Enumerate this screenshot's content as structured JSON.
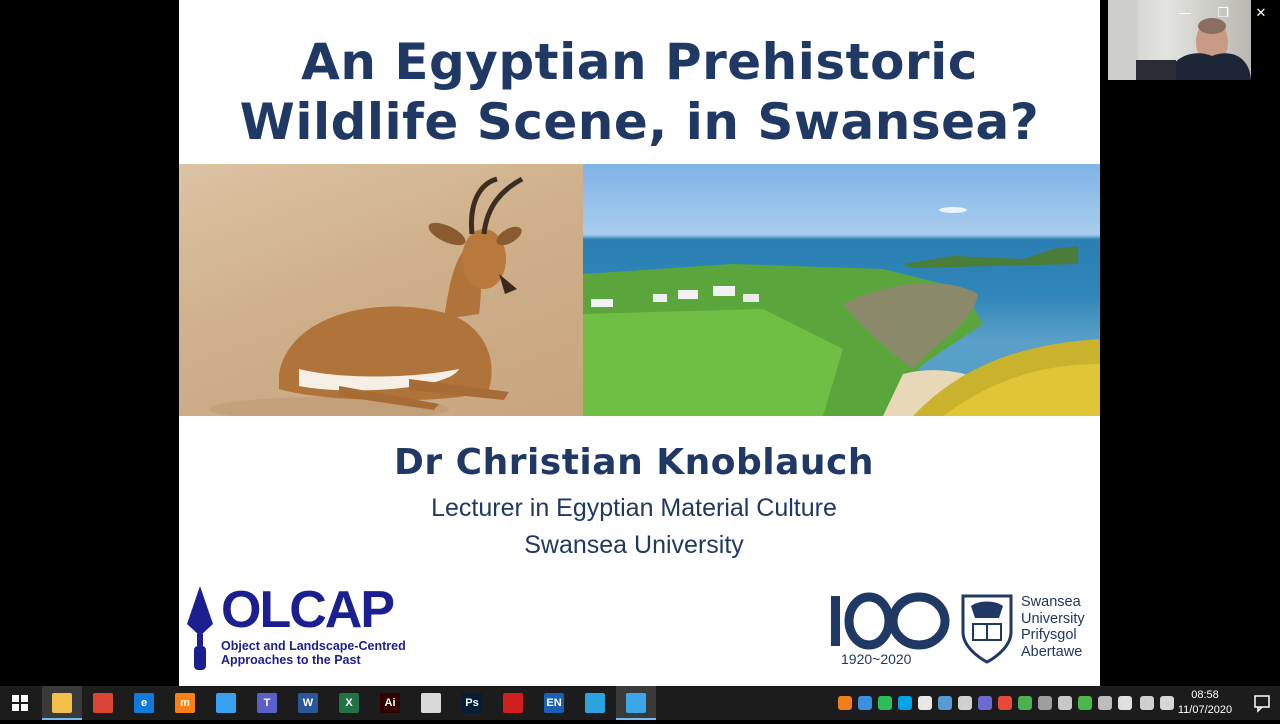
{
  "slide": {
    "title_line1": "An Egyptian Prehistoric",
    "title_line2": "Wildlife Scene, in Swansea?",
    "presenter_name": "Dr Christian Knoblauch",
    "presenter_role": "Lecturer in Egyptian Material Culture",
    "presenter_org": "Swansea University",
    "olcap_word": "OLCAP",
    "olcap_sub_line1": "Object and Landscape-Centred",
    "olcap_sub_line2": "Approaches to the Past",
    "centenary_years": "1920~2020",
    "uni_line1": "Swansea",
    "uni_line2": "University",
    "uni_line3": "Prifysgol",
    "uni_line4": "Abertawe"
  },
  "taskbar": {
    "apps": [
      {
        "name": "file-explorer",
        "label": "",
        "color": "#f3c14b"
      },
      {
        "name": "chrome",
        "label": "",
        "color": "#db4437"
      },
      {
        "name": "edge",
        "label": "e",
        "color": "#0f7ad8"
      },
      {
        "name": "moodle",
        "label": "m",
        "color": "#f98012"
      },
      {
        "name": "snip",
        "label": "",
        "color": "#3aa0f0"
      },
      {
        "name": "teams",
        "label": "T",
        "color": "#5b5fc7"
      },
      {
        "name": "word",
        "label": "W",
        "color": "#2b579a"
      },
      {
        "name": "excel",
        "label": "X",
        "color": "#217346"
      },
      {
        "name": "illustrator",
        "label": "Ai",
        "color": "#330000"
      },
      {
        "name": "installer",
        "label": "",
        "color": "#d9d9d9"
      },
      {
        "name": "photoshop",
        "label": "Ps",
        "color": "#001e36"
      },
      {
        "name": "acrobat",
        "label": "",
        "color": "#d11f1f"
      },
      {
        "name": "language",
        "label": "EN",
        "color": "#1a5fb4"
      },
      {
        "name": "remote",
        "label": "",
        "color": "#2aa3df"
      },
      {
        "name": "media",
        "label": "",
        "color": "#3ba6e8"
      }
    ],
    "clock_time": "08:58",
    "clock_date": "11/07/2020"
  },
  "window": {
    "minimize": "—",
    "restore": "❐",
    "close": "✕"
  }
}
